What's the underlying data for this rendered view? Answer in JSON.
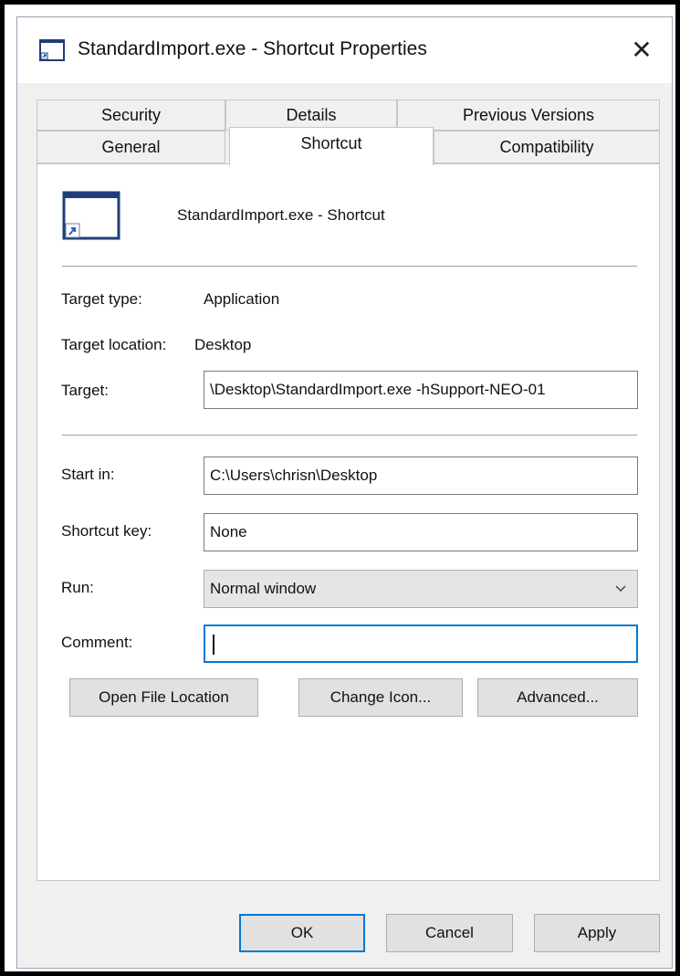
{
  "window": {
    "title": "StandardImport.exe - Shortcut Properties",
    "close_glyph": "✕"
  },
  "tabs": {
    "row1": [
      {
        "label": "Security"
      },
      {
        "label": "Details"
      },
      {
        "label": "Previous Versions"
      }
    ],
    "row2": [
      {
        "label": "General"
      },
      {
        "label": "Shortcut",
        "active": true
      },
      {
        "label": "Compatibility"
      }
    ]
  },
  "shortcut": {
    "name": "StandardImport.exe - Shortcut",
    "icon": "application-shortcut-icon"
  },
  "fields": {
    "target_type": {
      "label": "Target type:",
      "value": "Application"
    },
    "target_location": {
      "label": "Target location:",
      "value": "Desktop"
    },
    "target": {
      "label": "Target:",
      "value": "\\Desktop\\StandardImport.exe -hSupport-NEO-01"
    },
    "start_in": {
      "label": "Start in:",
      "value": "C:\\Users\\chrisn\\Desktop"
    },
    "shortcut_key": {
      "label": "Shortcut key:",
      "value": "None"
    },
    "run": {
      "label": "Run:",
      "value": "Normal window"
    },
    "comment": {
      "label": "Comment:",
      "value": ""
    }
  },
  "buttons": {
    "open_file_location": "Open File Location",
    "change_icon": "Change Icon...",
    "advanced": "Advanced...",
    "ok": "OK",
    "cancel": "Cancel",
    "apply": "Apply"
  },
  "colors": {
    "accent": "#0078d7",
    "window_bg": "#f0f0f0",
    "content_bg": "#ffffff"
  }
}
